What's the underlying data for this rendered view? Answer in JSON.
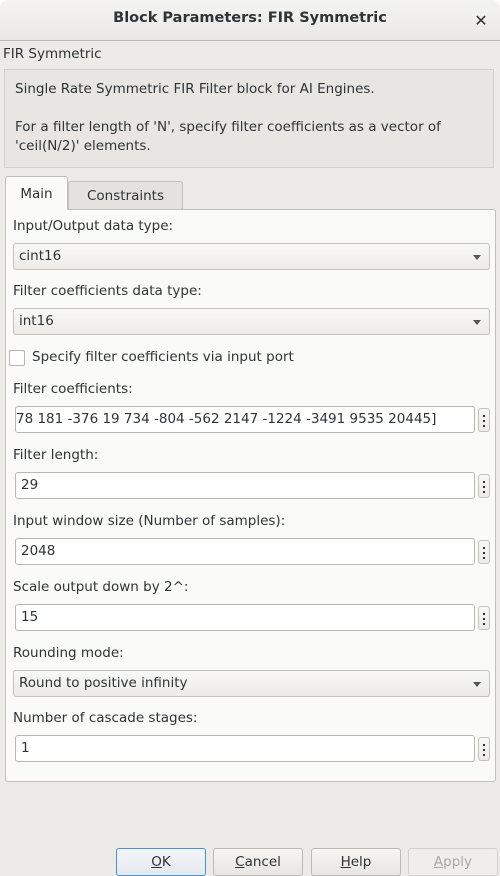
{
  "window": {
    "title": "Block Parameters: FIR Symmetric",
    "close_icon": "close-icon"
  },
  "block": {
    "name": "FIR Symmetric",
    "description_line1": "Single Rate Symmetric FIR Filter block for AI Engines.",
    "description_line2": "For a filter length of 'N', specify filter coefficients as a vector of 'ceil(N/2)' elements."
  },
  "tabs": [
    {
      "label": "Main",
      "active": true
    },
    {
      "label": "Constraints",
      "active": false
    }
  ],
  "params": {
    "io_type": {
      "label": "Input/Output data type:",
      "value": "cint16"
    },
    "coef_type": {
      "label": "Filter coefficients data type:",
      "value": "int16"
    },
    "coef_port": {
      "label": "Specify filter coefficients via input port",
      "checked": false
    },
    "coefficients": {
      "label": "Filter coefficients:",
      "value": "78 181 -376 19 734 -804 -562 2147 -1224 -3491 9535 20445]"
    },
    "filter_length": {
      "label": "Filter length:",
      "value": "29"
    },
    "window_size": {
      "label": "Input window size (Number of samples):",
      "value": "2048"
    },
    "shift": {
      "label": "Scale output down by 2^:",
      "value": "15"
    },
    "rounding": {
      "label": "Rounding mode:",
      "value": "Round to positive infinity"
    },
    "cascade": {
      "label": "Number of cascade stages:",
      "value": "1"
    }
  },
  "buttons": {
    "ok": {
      "mnemonic": "O",
      "rest": "K"
    },
    "cancel": {
      "mnemonic": "C",
      "rest": "ancel"
    },
    "help": {
      "mnemonic": "H",
      "rest": "elp"
    },
    "apply": {
      "mnemonic": "A",
      "rest": "pply"
    }
  },
  "colors": {
    "default_button_border": "#4a90d9",
    "window_bg": "#edebe7",
    "panel_bg": "#fafaf8"
  }
}
